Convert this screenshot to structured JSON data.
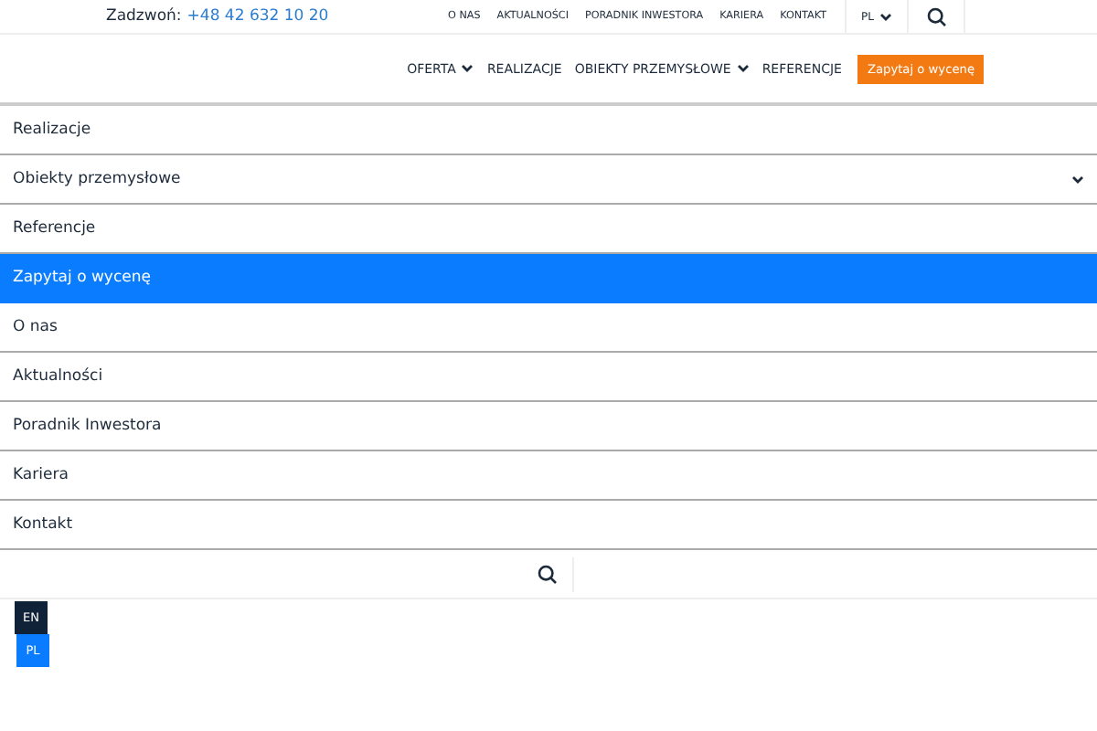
{
  "top_bar": {
    "call_label": "Zadzwoń:",
    "phone": "+48 42 632 10 20",
    "links": [
      "O NAS",
      "AKTUALNOŚCI",
      "PORADNIK INWESTORA",
      "KARIERA",
      "KONTAKT"
    ],
    "language": "PL"
  },
  "main_nav": {
    "items": [
      {
        "label": "OFERTA",
        "kind": "dropdown"
      },
      {
        "label": "REALIZACJE",
        "kind": "link"
      },
      {
        "label": "OBIEKTY PRZEMYSŁOWE",
        "kind": "dropdown"
      },
      {
        "label": "REFERENCJE",
        "kind": "link"
      }
    ],
    "cta": "Zapytaj o wycenę"
  },
  "mobile_menu": [
    {
      "label": "Realizacje",
      "kind": "link",
      "selected": false
    },
    {
      "label": "Obiekty przemysłowe",
      "kind": "dropdown",
      "selected": false
    },
    {
      "label": "Referencje",
      "kind": "link",
      "selected": false
    },
    {
      "label": "Zapytaj o wycenę",
      "kind": "link",
      "selected": true
    },
    {
      "label": "O nas",
      "kind": "link",
      "selected": false
    },
    {
      "label": "Aktualności",
      "kind": "link",
      "selected": false
    },
    {
      "label": "Poradnik Inwestora",
      "kind": "link",
      "selected": false
    },
    {
      "label": "Kariera",
      "kind": "link",
      "selected": false
    },
    {
      "label": "Kontakt",
      "kind": "link",
      "selected": false
    }
  ],
  "languages": [
    {
      "label": "EN",
      "selected": false
    },
    {
      "label": "PL",
      "selected": true
    }
  ]
}
